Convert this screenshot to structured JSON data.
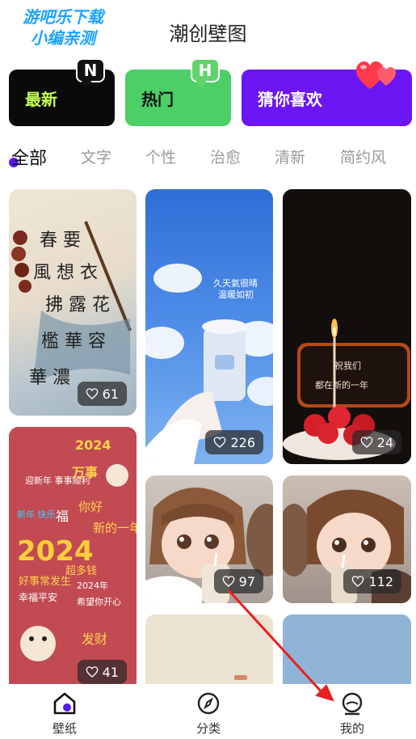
{
  "watermark": {
    "line1": "游吧乐下载",
    "line2": "小编亲测"
  },
  "header": {
    "title": "潮创壁图"
  },
  "cards": [
    {
      "label": "最新",
      "badge": "N"
    },
    {
      "label": "热门",
      "badge": "H"
    },
    {
      "label": "猜你喜欢",
      "badge_icon": "hearts-icon"
    }
  ],
  "tabs": [
    {
      "label": "全部",
      "active": true
    },
    {
      "label": "文字"
    },
    {
      "label": "个性"
    },
    {
      "label": "治愈"
    },
    {
      "label": "清新"
    },
    {
      "label": "简约风"
    }
  ],
  "wallpapers": [
    {
      "likes": "61",
      "subject": "calligraphy"
    },
    {
      "likes": "41",
      "subject": "2024 greetings"
    },
    {
      "likes": "226",
      "subject": "cup and sky"
    },
    {
      "likes": "97",
      "subject": "girl with drink"
    },
    {
      "likes": "24",
      "subject": "candle cake"
    },
    {
      "likes": "112",
      "subject": "boy with drink"
    }
  ],
  "bottom_nav": [
    {
      "label": "壁纸",
      "icon": "wallpaper-home-icon",
      "active": true
    },
    {
      "label": "分类",
      "icon": "compass-icon"
    },
    {
      "label": "我的",
      "icon": "profile-icon"
    }
  ],
  "colors": {
    "accent": "#6c16f4",
    "new_card": "#0a0a0a",
    "hot_card": "#4ccf67",
    "annotation_arrow": "#e8201f"
  }
}
